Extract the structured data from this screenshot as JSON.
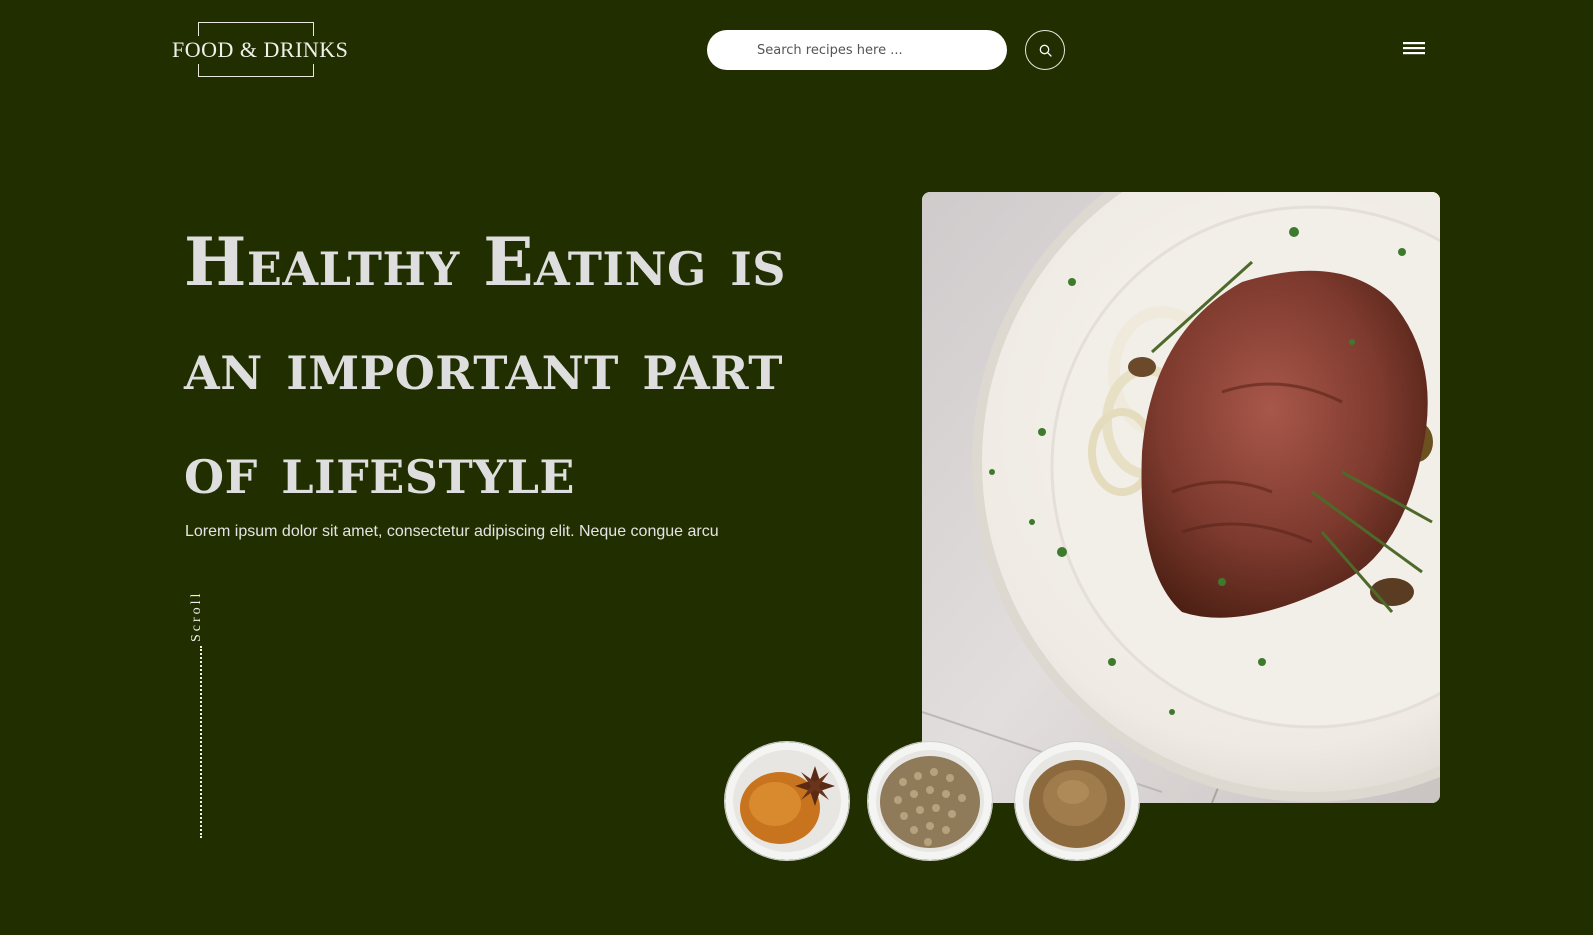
{
  "header": {
    "logo_text": "FOOD & DRINKS",
    "search_placeholder": "Search recipes here ...",
    "search_icon": "search-icon",
    "menu_icon": "hamburger-menu-icon"
  },
  "hero": {
    "title_lines": [
      "Healthy Eating is",
      "an important part",
      "of lifestyle"
    ],
    "subtitle": "Lorem ipsum dolor sit amet, consectetur adipiscing elit. Neque congue arcu",
    "scroll_label": "Scroll"
  },
  "images": {
    "main": "steak-plate-photo",
    "spices": [
      "turmeric-star-anise-bowl",
      "coriander-seeds-bowl",
      "ground-spice-bowl"
    ]
  },
  "colors": {
    "background": "#212e00",
    "title": "#dedede",
    "accent_white": "#ffffff"
  }
}
